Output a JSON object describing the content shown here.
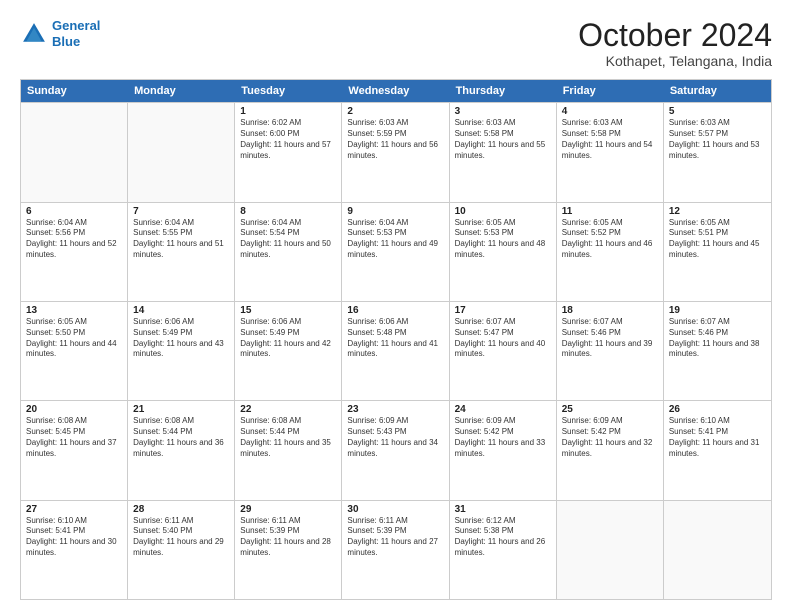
{
  "logo": {
    "line1": "General",
    "line2": "Blue"
  },
  "header": {
    "month": "October 2024",
    "location": "Kothapet, Telangana, India"
  },
  "days": [
    "Sunday",
    "Monday",
    "Tuesday",
    "Wednesday",
    "Thursday",
    "Friday",
    "Saturday"
  ],
  "rows": [
    [
      {
        "day": "",
        "empty": true
      },
      {
        "day": "",
        "empty": true
      },
      {
        "day": "1",
        "sunrise": "Sunrise: 6:02 AM",
        "sunset": "Sunset: 6:00 PM",
        "daylight": "Daylight: 11 hours and 57 minutes."
      },
      {
        "day": "2",
        "sunrise": "Sunrise: 6:03 AM",
        "sunset": "Sunset: 5:59 PM",
        "daylight": "Daylight: 11 hours and 56 minutes."
      },
      {
        "day": "3",
        "sunrise": "Sunrise: 6:03 AM",
        "sunset": "Sunset: 5:58 PM",
        "daylight": "Daylight: 11 hours and 55 minutes."
      },
      {
        "day": "4",
        "sunrise": "Sunrise: 6:03 AM",
        "sunset": "Sunset: 5:58 PM",
        "daylight": "Daylight: 11 hours and 54 minutes."
      },
      {
        "day": "5",
        "sunrise": "Sunrise: 6:03 AM",
        "sunset": "Sunset: 5:57 PM",
        "daylight": "Daylight: 11 hours and 53 minutes."
      }
    ],
    [
      {
        "day": "6",
        "sunrise": "Sunrise: 6:04 AM",
        "sunset": "Sunset: 5:56 PM",
        "daylight": "Daylight: 11 hours and 52 minutes."
      },
      {
        "day": "7",
        "sunrise": "Sunrise: 6:04 AM",
        "sunset": "Sunset: 5:55 PM",
        "daylight": "Daylight: 11 hours and 51 minutes."
      },
      {
        "day": "8",
        "sunrise": "Sunrise: 6:04 AM",
        "sunset": "Sunset: 5:54 PM",
        "daylight": "Daylight: 11 hours and 50 minutes."
      },
      {
        "day": "9",
        "sunrise": "Sunrise: 6:04 AM",
        "sunset": "Sunset: 5:53 PM",
        "daylight": "Daylight: 11 hours and 49 minutes."
      },
      {
        "day": "10",
        "sunrise": "Sunrise: 6:05 AM",
        "sunset": "Sunset: 5:53 PM",
        "daylight": "Daylight: 11 hours and 48 minutes."
      },
      {
        "day": "11",
        "sunrise": "Sunrise: 6:05 AM",
        "sunset": "Sunset: 5:52 PM",
        "daylight": "Daylight: 11 hours and 46 minutes."
      },
      {
        "day": "12",
        "sunrise": "Sunrise: 6:05 AM",
        "sunset": "Sunset: 5:51 PM",
        "daylight": "Daylight: 11 hours and 45 minutes."
      }
    ],
    [
      {
        "day": "13",
        "sunrise": "Sunrise: 6:05 AM",
        "sunset": "Sunset: 5:50 PM",
        "daylight": "Daylight: 11 hours and 44 minutes."
      },
      {
        "day": "14",
        "sunrise": "Sunrise: 6:06 AM",
        "sunset": "Sunset: 5:49 PM",
        "daylight": "Daylight: 11 hours and 43 minutes."
      },
      {
        "day": "15",
        "sunrise": "Sunrise: 6:06 AM",
        "sunset": "Sunset: 5:49 PM",
        "daylight": "Daylight: 11 hours and 42 minutes."
      },
      {
        "day": "16",
        "sunrise": "Sunrise: 6:06 AM",
        "sunset": "Sunset: 5:48 PM",
        "daylight": "Daylight: 11 hours and 41 minutes."
      },
      {
        "day": "17",
        "sunrise": "Sunrise: 6:07 AM",
        "sunset": "Sunset: 5:47 PM",
        "daylight": "Daylight: 11 hours and 40 minutes."
      },
      {
        "day": "18",
        "sunrise": "Sunrise: 6:07 AM",
        "sunset": "Sunset: 5:46 PM",
        "daylight": "Daylight: 11 hours and 39 minutes."
      },
      {
        "day": "19",
        "sunrise": "Sunrise: 6:07 AM",
        "sunset": "Sunset: 5:46 PM",
        "daylight": "Daylight: 11 hours and 38 minutes."
      }
    ],
    [
      {
        "day": "20",
        "sunrise": "Sunrise: 6:08 AM",
        "sunset": "Sunset: 5:45 PM",
        "daylight": "Daylight: 11 hours and 37 minutes."
      },
      {
        "day": "21",
        "sunrise": "Sunrise: 6:08 AM",
        "sunset": "Sunset: 5:44 PM",
        "daylight": "Daylight: 11 hours and 36 minutes."
      },
      {
        "day": "22",
        "sunrise": "Sunrise: 6:08 AM",
        "sunset": "Sunset: 5:44 PM",
        "daylight": "Daylight: 11 hours and 35 minutes."
      },
      {
        "day": "23",
        "sunrise": "Sunrise: 6:09 AM",
        "sunset": "Sunset: 5:43 PM",
        "daylight": "Daylight: 11 hours and 34 minutes."
      },
      {
        "day": "24",
        "sunrise": "Sunrise: 6:09 AM",
        "sunset": "Sunset: 5:42 PM",
        "daylight": "Daylight: 11 hours and 33 minutes."
      },
      {
        "day": "25",
        "sunrise": "Sunrise: 6:09 AM",
        "sunset": "Sunset: 5:42 PM",
        "daylight": "Daylight: 11 hours and 32 minutes."
      },
      {
        "day": "26",
        "sunrise": "Sunrise: 6:10 AM",
        "sunset": "Sunset: 5:41 PM",
        "daylight": "Daylight: 11 hours and 31 minutes."
      }
    ],
    [
      {
        "day": "27",
        "sunrise": "Sunrise: 6:10 AM",
        "sunset": "Sunset: 5:41 PM",
        "daylight": "Daylight: 11 hours and 30 minutes."
      },
      {
        "day": "28",
        "sunrise": "Sunrise: 6:11 AM",
        "sunset": "Sunset: 5:40 PM",
        "daylight": "Daylight: 11 hours and 29 minutes."
      },
      {
        "day": "29",
        "sunrise": "Sunrise: 6:11 AM",
        "sunset": "Sunset: 5:39 PM",
        "daylight": "Daylight: 11 hours and 28 minutes."
      },
      {
        "day": "30",
        "sunrise": "Sunrise: 6:11 AM",
        "sunset": "Sunset: 5:39 PM",
        "daylight": "Daylight: 11 hours and 27 minutes."
      },
      {
        "day": "31",
        "sunrise": "Sunrise: 6:12 AM",
        "sunset": "Sunset: 5:38 PM",
        "daylight": "Daylight: 11 hours and 26 minutes."
      },
      {
        "day": "",
        "empty": true
      },
      {
        "day": "",
        "empty": true
      }
    ]
  ]
}
